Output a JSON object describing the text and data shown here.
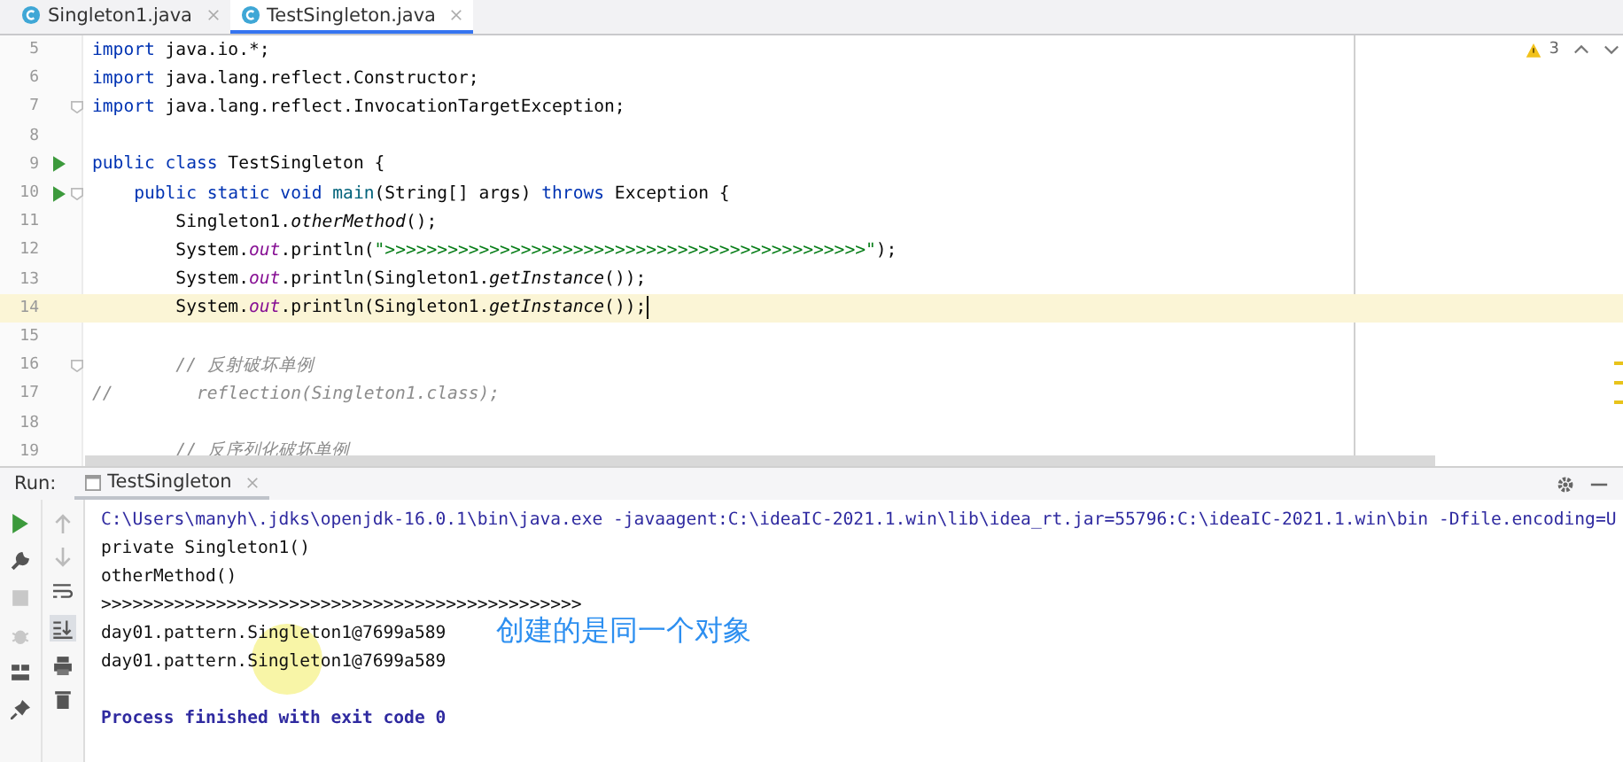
{
  "editor_tabs": [
    {
      "label": "Singleton1.java",
      "selected": false
    },
    {
      "label": "TestSingleton.java",
      "selected": true
    }
  ],
  "editor": {
    "inspection_count": "3",
    "lines": [
      {
        "number": "5",
        "run": false,
        "fold": false,
        "current": false,
        "tokens": [
          {
            "kind": "kw",
            "t": "import"
          },
          {
            "kind": "plain",
            "t": " java.io.*;"
          }
        ]
      },
      {
        "number": "6",
        "run": false,
        "fold": false,
        "current": false,
        "tokens": [
          {
            "kind": "kw",
            "t": "import"
          },
          {
            "kind": "plain",
            "t": " java.lang.reflect.Constructor;"
          }
        ]
      },
      {
        "number": "7",
        "run": false,
        "fold": true,
        "current": false,
        "tokens": [
          {
            "kind": "kw",
            "t": "import"
          },
          {
            "kind": "plain",
            "t": " java.lang.reflect.InvocationTargetException;"
          }
        ]
      },
      {
        "number": "8",
        "run": false,
        "fold": false,
        "current": false
      },
      {
        "number": "9",
        "run": true,
        "fold": false,
        "current": false,
        "tokens": [
          {
            "kind": "kw",
            "t": "public class"
          },
          {
            "kind": "plain",
            "t": " TestSingleton {"
          }
        ]
      },
      {
        "number": "10",
        "run": true,
        "fold": true,
        "current": false,
        "tokens": [
          {
            "kind": "kw",
            "t": "    public static void"
          },
          {
            "kind": "decl",
            "t": " main"
          },
          {
            "kind": "plain",
            "t": "(String[] args) "
          },
          {
            "kind": "kw",
            "t": "throws"
          },
          {
            "kind": "plain",
            "t": " Exception {"
          }
        ]
      },
      {
        "number": "11",
        "run": false,
        "fold": false,
        "current": false,
        "tokens": [
          {
            "kind": "plain",
            "t": "        Singleton1."
          },
          {
            "kind": "static",
            "t": "otherMethod"
          },
          {
            "kind": "plain",
            "t": "();"
          }
        ]
      },
      {
        "number": "12",
        "run": false,
        "fold": false,
        "current": false,
        "tokens": [
          {
            "kind": "plain",
            "t": "        System."
          },
          {
            "kind": "field",
            "t": "out"
          },
          {
            "kind": "plain",
            "t": ".println("
          },
          {
            "kind": "string",
            "t": "\">>>>>>>>>>>>>>>>>>>>>>>>>>>>>>>>>>>>>>>>>>>>>>\""
          },
          {
            "kind": "plain",
            "t": ");"
          }
        ]
      },
      {
        "number": "13",
        "run": false,
        "fold": false,
        "current": false,
        "tokens": [
          {
            "kind": "plain",
            "t": "        System."
          },
          {
            "kind": "field",
            "t": "out"
          },
          {
            "kind": "plain",
            "t": ".println(Singleton1."
          },
          {
            "kind": "static",
            "t": "getInstance"
          },
          {
            "kind": "plain",
            "t": "());"
          }
        ]
      },
      {
        "number": "14",
        "run": false,
        "fold": false,
        "current": true,
        "tokens": [
          {
            "kind": "plain",
            "t": "        System."
          },
          {
            "kind": "field",
            "t": "out"
          },
          {
            "kind": "plain",
            "t": ".println(Singleton1."
          },
          {
            "kind": "static",
            "t": "getInstance"
          },
          {
            "kind": "plain",
            "t": "());"
          }
        ]
      },
      {
        "number": "15",
        "run": false,
        "fold": false,
        "current": false
      },
      {
        "number": "16",
        "run": false,
        "fold": true,
        "current": false,
        "tokens": [
          {
            "kind": "comment",
            "t": "        // 反射破坏单例"
          }
        ]
      },
      {
        "number": "17",
        "run": false,
        "fold": false,
        "current": false,
        "tokens": [
          {
            "kind": "comment",
            "t": "//        reflection(Singleton1.class);"
          }
        ]
      },
      {
        "number": "18",
        "run": false,
        "fold": false,
        "current": false
      },
      {
        "number": "19",
        "run": false,
        "fold": false,
        "current": false,
        "tokens": [
          {
            "kind": "comment",
            "t": "        // 反序列化破坏单例"
          }
        ]
      }
    ]
  },
  "run_panel": {
    "label": "Run:",
    "tabs": [
      {
        "label": "TestSingleton",
        "selected": true
      }
    ],
    "console": [
      {
        "kind": "command",
        "text": "C:\\Users\\manyh\\.jdks\\openjdk-16.0.1\\bin\\java.exe -javaagent:C:\\ideaIC-2021.1.win\\lib\\idea_rt.jar=55796:C:\\ideaIC-2021.1.win\\bin -Dfile.encoding=U"
      },
      {
        "kind": "output",
        "text": "private Singleton1()"
      },
      {
        "kind": "output",
        "text": "otherMethod()"
      },
      {
        "kind": "output",
        "text": ">>>>>>>>>>>>>>>>>>>>>>>>>>>>>>>>>>>>>>>>>>>>>>"
      },
      {
        "kind": "output",
        "text": "day01.pattern.Singleton1@7699a589"
      },
      {
        "kind": "output",
        "text": "day01.pattern.Singleton1@7699a589"
      },
      {
        "kind": "blank"
      },
      {
        "kind": "exit",
        "text": "Process finished with exit code 0"
      }
    ]
  },
  "annotation": "创建的是同一个对象"
}
